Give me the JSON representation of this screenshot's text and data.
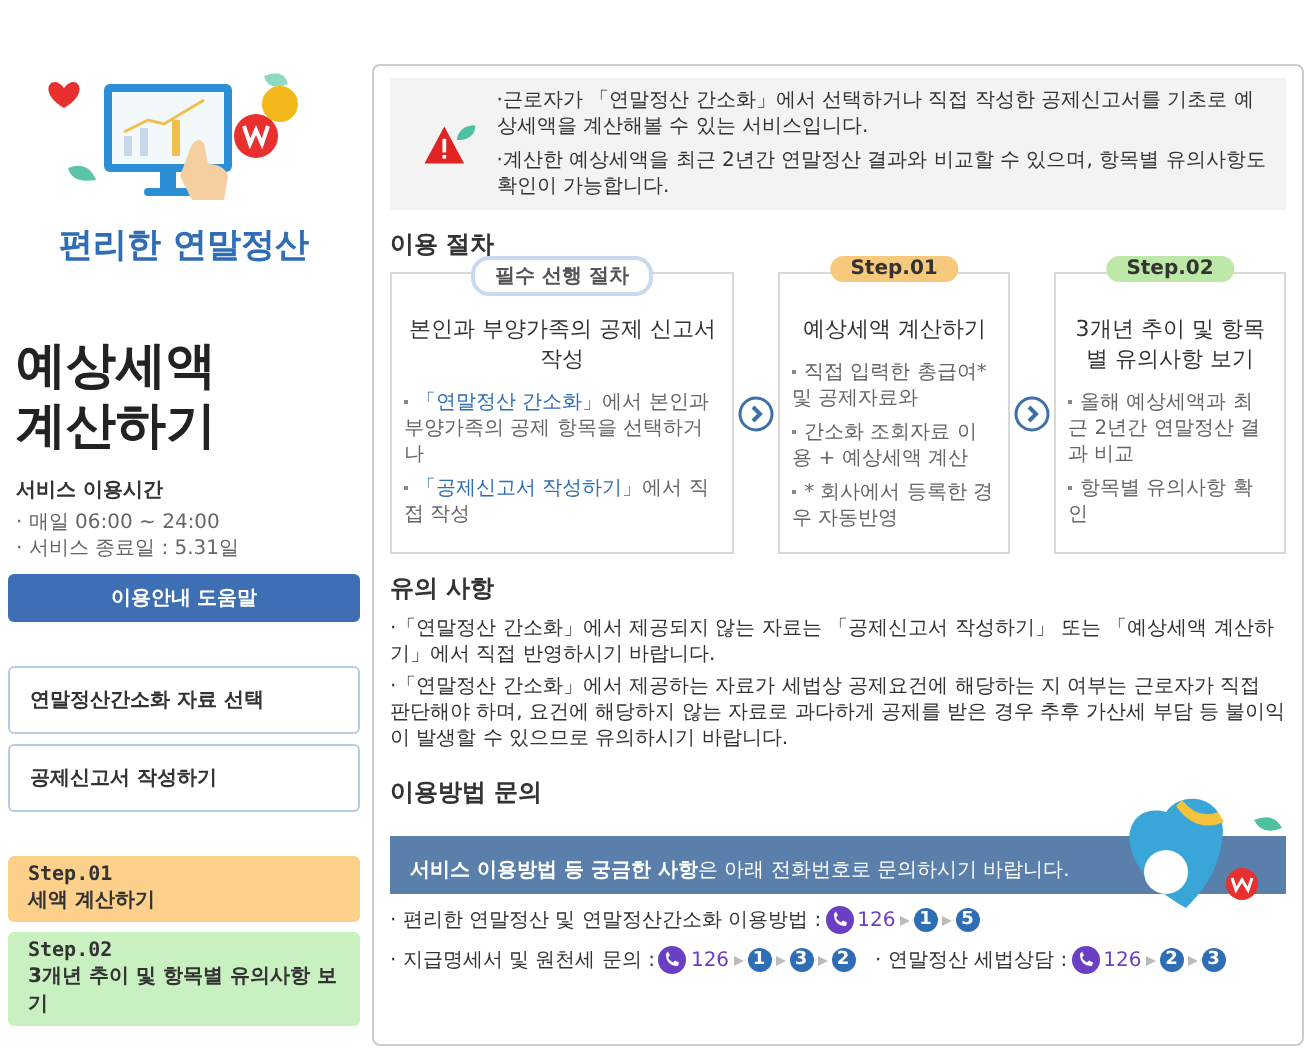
{
  "sidebar": {
    "logo_caption": "편리한 연말정산",
    "title": "예상세액 계산하기",
    "service_hours": {
      "label": "서비스 이용시간",
      "items": [
        "· 매일 06:00 ~ 24:00",
        "· 서비스 종료일 : 5.31일"
      ]
    },
    "help_button": "이용안내 도움말",
    "menu_items": [
      {
        "label": "연말정산간소화 자료 선택"
      },
      {
        "label": "공제신고서 작성하기"
      }
    ],
    "steps": [
      {
        "step": "Step.01",
        "label": "세액 계산하기",
        "color": "#fdd08c"
      },
      {
        "step": "Step.02",
        "label": "3개년 추이 및 항목별 유의사항 보기",
        "color": "#c9f0c0"
      }
    ]
  },
  "notice": [
    "·근로자가 「연말정산 간소화」에서 선택하거나 직접 작성한 공제신고서를 기초로 예상세액을 계산해볼 수 있는 서비스입니다.",
    "·계산한 예상세액을 최근 2년간 연말정산 결과와 비교할 수 있으며, 항목별 유의사항도 확인이 가능합니다."
  ],
  "procedure": {
    "title": "이용 절차",
    "cards": [
      {
        "badge": "필수 선행 절차",
        "kind": "required",
        "title": "본인과 부양가족의 공제 신고서 작성",
        "items": [
          {
            "link": "「연말정산 간소화」",
            "text": "에서 본인과 부양가족의 공제 항목을 선택하거나"
          },
          {
            "link": "「공제신고서 작성하기」",
            "text": "에서 직접 작성"
          }
        ]
      },
      {
        "badge": "Step.01",
        "kind": "step1",
        "title": "예상세액 계산하기",
        "items": [
          {
            "text": "직접 입력한 총급여* 및 공제자료와"
          },
          {
            "text": "간소화 조회자료 이용 + 예상세액 계산"
          },
          {
            "text": "* 회사에서 등록한 경우 자동반영"
          }
        ]
      },
      {
        "badge": "Step.02",
        "kind": "step2",
        "title": "3개년 추이 및 항목별 유의사항 보기",
        "items": [
          {
            "text": "올해 예상세액과 최근 2년간 연말정산 결과 비교"
          },
          {
            "text": "항목별 유의사항 확인"
          }
        ]
      }
    ]
  },
  "cautions": {
    "title": "유의 사항",
    "items": [
      "·「연말정산 간소화」에서 제공되지 않는 자료는 「공제신고서 작성하기」 또는 「예상세액 계산하기」에서 직접 반영하시기 바랍니다.",
      "·「연말정산 간소화」에서 제공하는 자료가 세법상 공제요건에 해당하는 지 여부는 근로자가 직접 판단해야 하며, 요건에 해당하지 않는 자료로 과다하게 공제를 받은 경우 추후 가산세 부담 등 불이익이 발생할 수 있으므로 유의하시기 바랍니다."
    ]
  },
  "inquiry": {
    "title": "이용방법 문의",
    "banner": "**서비스 이용방법 등 궁금한 사항**은 아래 전화번호로 문의하시기 바랍니다.",
    "lines": [
      [
        {
          "label": "· 편리한 연말정산 및 연말정산간소화 이용방법 :",
          "number": "126",
          "keys": [
            "1",
            "5"
          ]
        }
      ],
      [
        {
          "label": "· 지급명세서  및 원천세 문의 :",
          "number": "126",
          "keys": [
            "1",
            "3",
            "2"
          ]
        },
        {
          "label": "· 연말정산 세법상담 :",
          "number": "126",
          "keys": [
            "2",
            "3"
          ]
        }
      ]
    ]
  }
}
